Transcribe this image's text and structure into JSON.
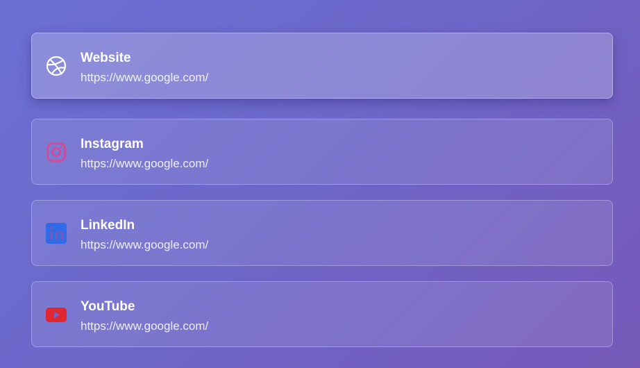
{
  "links": [
    {
      "title": "Website",
      "url": "https://www.google.com/",
      "icon": "dribbble-globe-icon",
      "icon_color": "#ffffff",
      "active": true
    },
    {
      "title": "Instagram",
      "url": "https://www.google.com/",
      "icon": "instagram-icon",
      "icon_color": "#e4418f",
      "active": false
    },
    {
      "title": "LinkedIn",
      "url": "https://www.google.com/",
      "icon": "linkedin-icon",
      "icon_color": "#2f6be8",
      "active": false
    },
    {
      "title": "YouTube",
      "url": "https://www.google.com/",
      "icon": "youtube-icon",
      "icon_color": "#e0262f",
      "active": false
    }
  ]
}
